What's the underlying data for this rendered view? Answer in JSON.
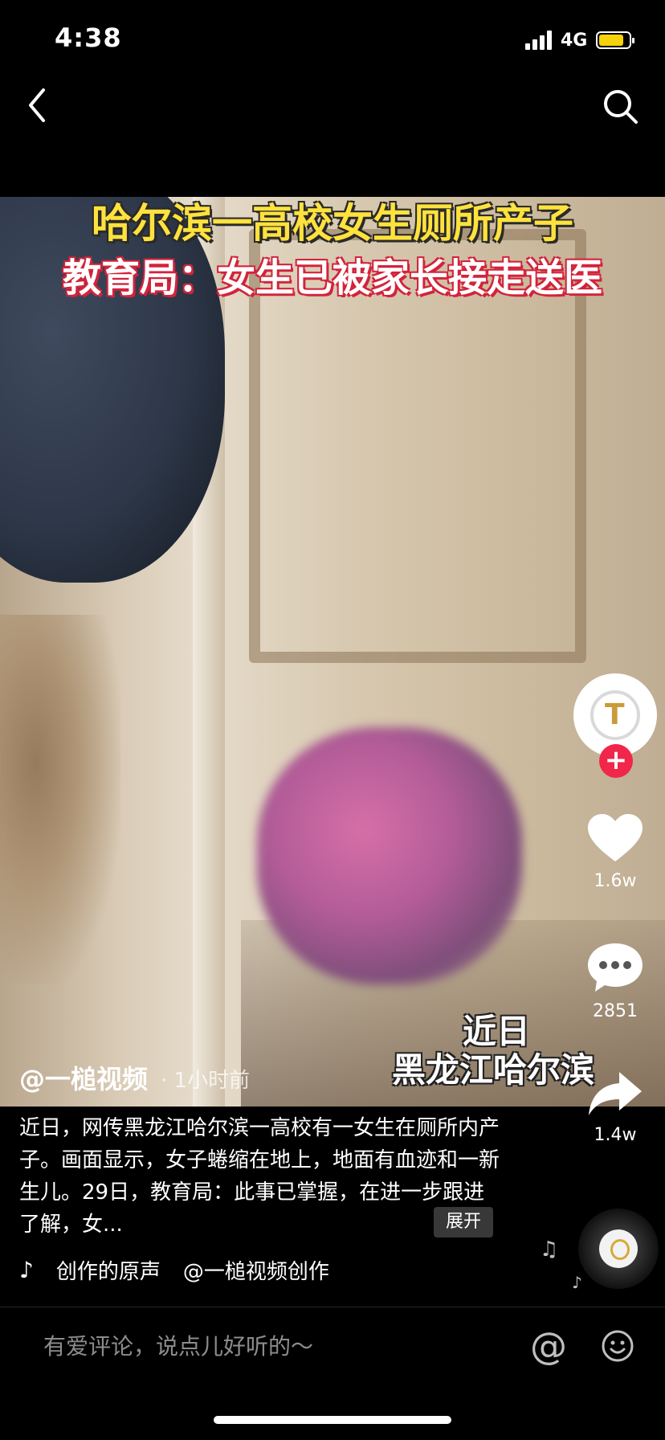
{
  "status_bar": {
    "time": "4:38",
    "network": "4G",
    "battery_color": "#f5d20a"
  },
  "nav": {
    "back_icon": "chevron-left-icon",
    "search_icon": "search-icon"
  },
  "video": {
    "caption_line1": "哈尔滨一高校女生厕所产子",
    "caption_line2": "教育局：女生已被家长接走送医",
    "location_line1": "近日",
    "location_line2": "黑龙江哈尔滨"
  },
  "actions": {
    "like_count": "1.6w",
    "comment_count": "2851",
    "share_count": "1.4w",
    "follow_symbol": "+"
  },
  "post": {
    "author": "@一槌视频",
    "time_ago": "· 1小时前",
    "description": "近日，网传黑龙江哈尔滨一高校有一女生在厕所内产子。画面显示，女子蜷缩在地上，地面有血迹和一新生儿。29日，教育局：此事已掌握，在进一步跟进了解，女...",
    "expand_label": "展开",
    "music_title": "创作的原声",
    "music_author": "@一槌视频创作"
  },
  "comment_bar": {
    "placeholder": "有爱评论，说点儿好听的～",
    "at_symbol": "@"
  },
  "colors": {
    "accent": "#f0264b",
    "caption_yellow": "#ffe23d",
    "caption_red": "#d3233b"
  }
}
